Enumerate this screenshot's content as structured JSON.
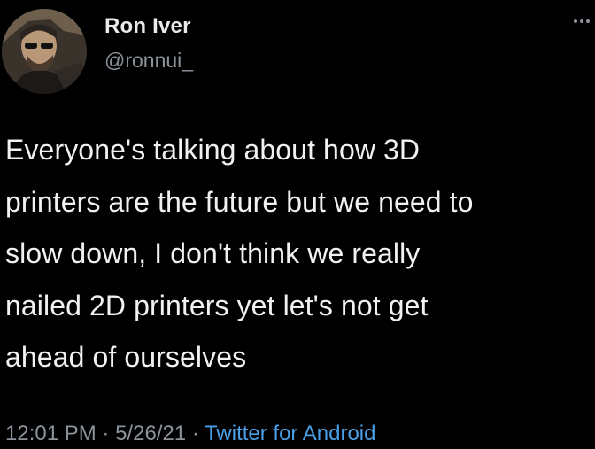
{
  "author": {
    "display_name": "Ron Iver",
    "handle": "@ronnui_"
  },
  "tweet": {
    "text": "Everyone's talking about how 3D\nprinters are the future but we need to\nslow down, I don't think we really\nnailed 2D printers yet let's not get\nahead of ourselves"
  },
  "meta": {
    "time": "12:01 PM",
    "separator": "·",
    "date": "5/26/21",
    "source": "Twitter for Android"
  },
  "icons": {
    "more": "more-options-icon",
    "avatar": "profile-photo"
  },
  "colors": {
    "background": "#000000",
    "text": "#f0f1f1",
    "secondary": "#8b9299",
    "link": "#4a9fe6"
  }
}
